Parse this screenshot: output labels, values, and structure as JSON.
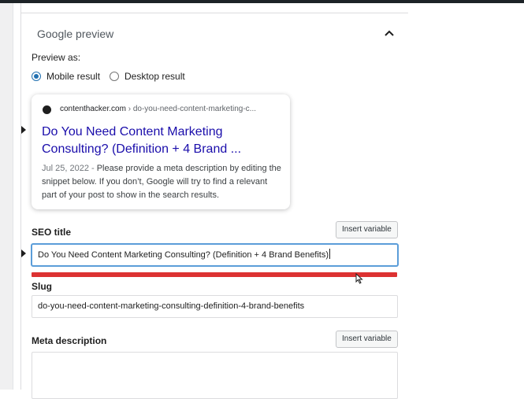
{
  "section": {
    "title": "Google preview"
  },
  "preview": {
    "label": "Preview as:",
    "options": [
      {
        "label": "Mobile result",
        "selected": true
      },
      {
        "label": "Desktop result",
        "selected": false
      }
    ]
  },
  "snippet": {
    "site": "contenthacker.com",
    "path": " › do-you-need-content-marketing-c...",
    "title": "Do You Need Content Marketing Consulting? (Definition + 4 Brand ...",
    "date": "Jul 25, 2022",
    "separator": " - ",
    "description": "Please provide a meta description by editing the snippet below. If you don’t, Google will try to find a relevant part of your post to show in the search results."
  },
  "seo_title": {
    "label": "SEO title",
    "insert_label": "Insert variable",
    "value": "Do You Need Content Marketing Consulting? (Definition + 4 Brand Benefits)",
    "progress_fraction": 1.0,
    "progress_color": "#dc3232"
  },
  "slug": {
    "label": "Slug",
    "value": "do-you-need-content-marketing-consulting-definition-4-brand-benefits"
  },
  "meta_description": {
    "label": "Meta description",
    "insert_label": "Insert variable",
    "value": ""
  },
  "colors": {
    "accent": "#2271b1",
    "link_title": "#1a0dab",
    "focus_border": "#5b9dd9"
  },
  "icons": {
    "collapse": "chevron-up-icon",
    "favicon": "site-favicon-icon",
    "pointer": "mouse-cursor-icon"
  }
}
